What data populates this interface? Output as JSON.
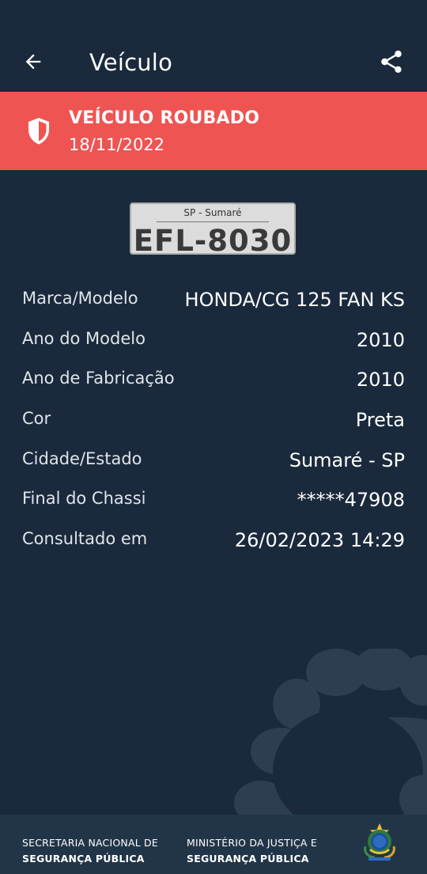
{
  "app_bar": {
    "title": "Veículo",
    "back_icon": "arrow-left-icon",
    "share_icon": "share-icon"
  },
  "alert": {
    "title": "VEÍCULO ROUBADO",
    "date": "18/11/2022",
    "icon": "shield-icon",
    "color": "#ee5452"
  },
  "plate": {
    "city": "SP - Sumaré",
    "number": "EFL-8030"
  },
  "details": [
    {
      "label": "Marca/Modelo",
      "value": "HONDA/CG 125 FAN KS"
    },
    {
      "label": "Ano do Modelo",
      "value": "2010"
    },
    {
      "label": "Ano de Fabricação",
      "value": "2010"
    },
    {
      "label": "Cor",
      "value": "Preta"
    },
    {
      "label": "Cidade/Estado",
      "value": "Sumaré - SP"
    },
    {
      "label": "Final do Chassi",
      "value": "*****47908"
    },
    {
      "label": "Consultado em",
      "value": "26/02/2023 14:29"
    }
  ],
  "footer": {
    "left_line1": "SECRETARIA NACIONAL DE",
    "left_line2": "SEGURANÇA PÚBLICA",
    "right_line1": "MINISTÉRIO DA JUSTIÇA E",
    "right_line2": "SEGURANÇA PÚBLICA",
    "emblem_icon": "coat-of-arms-icon"
  },
  "colors": {
    "background": "#1a2a3c",
    "footer": "#223548",
    "alert": "#ee5452"
  }
}
